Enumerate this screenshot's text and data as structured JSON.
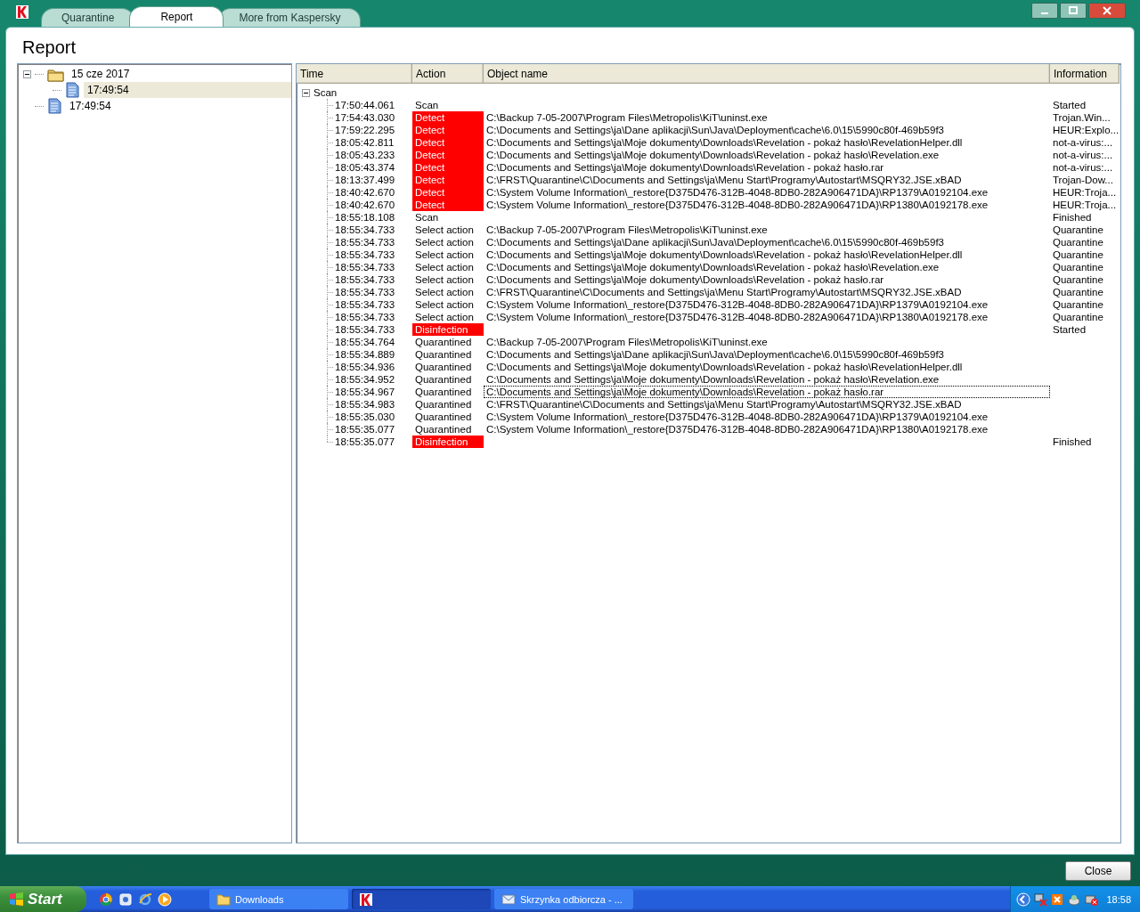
{
  "tabs": [
    {
      "label": "Quarantine",
      "selected": false
    },
    {
      "label": "Report",
      "selected": true
    },
    {
      "label": "More from Kaspersky",
      "selected": false
    }
  ],
  "heading": "Report",
  "sidebar": {
    "items": [
      {
        "label": "15 cze 2017",
        "kind": "folder",
        "expanded": true,
        "selected": false,
        "children": [
          {
            "label": "17:49:54",
            "kind": "document",
            "selected": true
          }
        ]
      },
      {
        "label": "17:49:54",
        "kind": "document",
        "selected": false
      }
    ]
  },
  "table": {
    "columns": [
      "Time",
      "Action",
      "Object name",
      "Information"
    ],
    "group": {
      "label": "Scan",
      "expanded": true
    },
    "rows": [
      {
        "time": "17:50:44.061",
        "action": "Scan",
        "alert": false,
        "focused": false,
        "info": "Started"
      },
      {
        "time": "17:54:43.030",
        "action": "Detect",
        "alert": true,
        "focused": false,
        "object": "C:\\Backup 7-05-2007\\Program Files\\Metropolis\\KiT\\uninst.exe",
        "info": "Trojan.Win..."
      },
      {
        "time": "17:59:22.295",
        "action": "Detect",
        "alert": true,
        "focused": false,
        "object": "C:\\Documents and Settings\\ja\\Dane aplikacji\\Sun\\Java\\Deployment\\cache\\6.0\\15\\5990c80f-469b59f3",
        "info": "HEUR:Explo..."
      },
      {
        "time": "18:05:42.811",
        "action": "Detect",
        "alert": true,
        "focused": false,
        "object": "C:\\Documents and Settings\\ja\\Moje dokumenty\\Downloads\\Revelation - pokaż hasło\\RevelationHelper.dll",
        "info": "not-a-virus:..."
      },
      {
        "time": "18:05:43.233",
        "action": "Detect",
        "alert": true,
        "focused": false,
        "object": "C:\\Documents and Settings\\ja\\Moje dokumenty\\Downloads\\Revelation - pokaż hasło\\Revelation.exe",
        "info": "not-a-virus:..."
      },
      {
        "time": "18:05:43.374",
        "action": "Detect",
        "alert": true,
        "focused": false,
        "object": "C:\\Documents and Settings\\ja\\Moje dokumenty\\Downloads\\Revelation - pokaż hasło.rar",
        "info": "not-a-virus:..."
      },
      {
        "time": "18:13:37.499",
        "action": "Detect",
        "alert": true,
        "focused": false,
        "object": "C:\\FRST\\Quarantine\\C\\Documents and Settings\\ja\\Menu Start\\Programy\\Autostart\\MSQRY32.JSE.xBAD",
        "info": "Trojan-Dow..."
      },
      {
        "time": "18:40:42.670",
        "action": "Detect",
        "alert": true,
        "focused": false,
        "object": "C:\\System Volume Information\\_restore{D375D476-312B-4048-8DB0-282A906471DA}\\RP1379\\A0192104.exe",
        "info": "HEUR:Troja..."
      },
      {
        "time": "18:40:42.670",
        "action": "Detect",
        "alert": true,
        "focused": false,
        "object": "C:\\System Volume Information\\_restore{D375D476-312B-4048-8DB0-282A906471DA}\\RP1380\\A0192178.exe",
        "info": "HEUR:Troja..."
      },
      {
        "time": "18:55:18.108",
        "action": "Scan",
        "alert": false,
        "focused": false,
        "info": "Finished"
      },
      {
        "time": "18:55:34.733",
        "action": "Select action",
        "alert": false,
        "focused": false,
        "object": "C:\\Backup 7-05-2007\\Program Files\\Metropolis\\KiT\\uninst.exe",
        "info": "Quarantine"
      },
      {
        "time": "18:55:34.733",
        "action": "Select action",
        "alert": false,
        "focused": false,
        "object": "C:\\Documents and Settings\\ja\\Dane aplikacji\\Sun\\Java\\Deployment\\cache\\6.0\\15\\5990c80f-469b59f3",
        "info": "Quarantine"
      },
      {
        "time": "18:55:34.733",
        "action": "Select action",
        "alert": false,
        "focused": false,
        "object": "C:\\Documents and Settings\\ja\\Moje dokumenty\\Downloads\\Revelation - pokaż hasło\\RevelationHelper.dll",
        "info": "Quarantine"
      },
      {
        "time": "18:55:34.733",
        "action": "Select action",
        "alert": false,
        "focused": false,
        "object": "C:\\Documents and Settings\\ja\\Moje dokumenty\\Downloads\\Revelation - pokaż hasło\\Revelation.exe",
        "info": "Quarantine"
      },
      {
        "time": "18:55:34.733",
        "action": "Select action",
        "alert": false,
        "focused": false,
        "object": "C:\\Documents and Settings\\ja\\Moje dokumenty\\Downloads\\Revelation - pokaż hasło.rar",
        "info": "Quarantine"
      },
      {
        "time": "18:55:34.733",
        "action": "Select action",
        "alert": false,
        "focused": false,
        "object": "C:\\FRST\\Quarantine\\C\\Documents and Settings\\ja\\Menu Start\\Programy\\Autostart\\MSQRY32.JSE.xBAD",
        "info": "Quarantine"
      },
      {
        "time": "18:55:34.733",
        "action": "Select action",
        "alert": false,
        "focused": false,
        "object": "C:\\System Volume Information\\_restore{D375D476-312B-4048-8DB0-282A906471DA}\\RP1379\\A0192104.exe",
        "info": "Quarantine"
      },
      {
        "time": "18:55:34.733",
        "action": "Select action",
        "alert": false,
        "focused": false,
        "object": "C:\\System Volume Information\\_restore{D375D476-312B-4048-8DB0-282A906471DA}\\RP1380\\A0192178.exe",
        "info": "Quarantine"
      },
      {
        "time": "18:55:34.733",
        "action": "Disinfection",
        "alert": true,
        "focused": false,
        "info": "Started"
      },
      {
        "time": "18:55:34.764",
        "action": "Quarantined",
        "alert": false,
        "focused": false,
        "object": "C:\\Backup 7-05-2007\\Program Files\\Metropolis\\KiT\\uninst.exe"
      },
      {
        "time": "18:55:34.889",
        "action": "Quarantined",
        "alert": false,
        "focused": false,
        "object": "C:\\Documents and Settings\\ja\\Dane aplikacji\\Sun\\Java\\Deployment\\cache\\6.0\\15\\5990c80f-469b59f3"
      },
      {
        "time": "18:55:34.936",
        "action": "Quarantined",
        "alert": false,
        "focused": false,
        "object": "C:\\Documents and Settings\\ja\\Moje dokumenty\\Downloads\\Revelation - pokaż hasło\\RevelationHelper.dll"
      },
      {
        "time": "18:55:34.952",
        "action": "Quarantined",
        "alert": false,
        "focused": false,
        "object": "C:\\Documents and Settings\\ja\\Moje dokumenty\\Downloads\\Revelation - pokaż hasło\\Revelation.exe"
      },
      {
        "time": "18:55:34.967",
        "action": "Quarantined",
        "alert": false,
        "focused": true,
        "object": "C:\\Documents and Settings\\ja\\Moje dokumenty\\Downloads\\Revelation - pokaż hasło.rar"
      },
      {
        "time": "18:55:34.983",
        "action": "Quarantined",
        "alert": false,
        "focused": false,
        "object": "C:\\FRST\\Quarantine\\C\\Documents and Settings\\ja\\Menu Start\\Programy\\Autostart\\MSQRY32.JSE.xBAD"
      },
      {
        "time": "18:55:35.030",
        "action": "Quarantined",
        "alert": false,
        "focused": false,
        "object": "C:\\System Volume Information\\_restore{D375D476-312B-4048-8DB0-282A906471DA}\\RP1379\\A0192104.exe"
      },
      {
        "time": "18:55:35.077",
        "action": "Quarantined",
        "alert": false,
        "focused": false,
        "object": "C:\\System Volume Information\\_restore{D375D476-312B-4048-8DB0-282A906471DA}\\RP1380\\A0192178.exe"
      },
      {
        "time": "18:55:35.077",
        "action": "Disinfection",
        "alert": true,
        "focused": false,
        "info": "Finished"
      }
    ]
  },
  "close_button": "Close",
  "taskbar": {
    "start": "Start",
    "tasks": [
      {
        "label": "Downloads",
        "kind": "folder",
        "selected": false
      },
      {
        "kind": "app",
        "selected": true
      },
      {
        "label": "Skrzynka odbiorcza - ...",
        "kind": "mail",
        "selected": false
      }
    ],
    "clock": "18:58"
  }
}
